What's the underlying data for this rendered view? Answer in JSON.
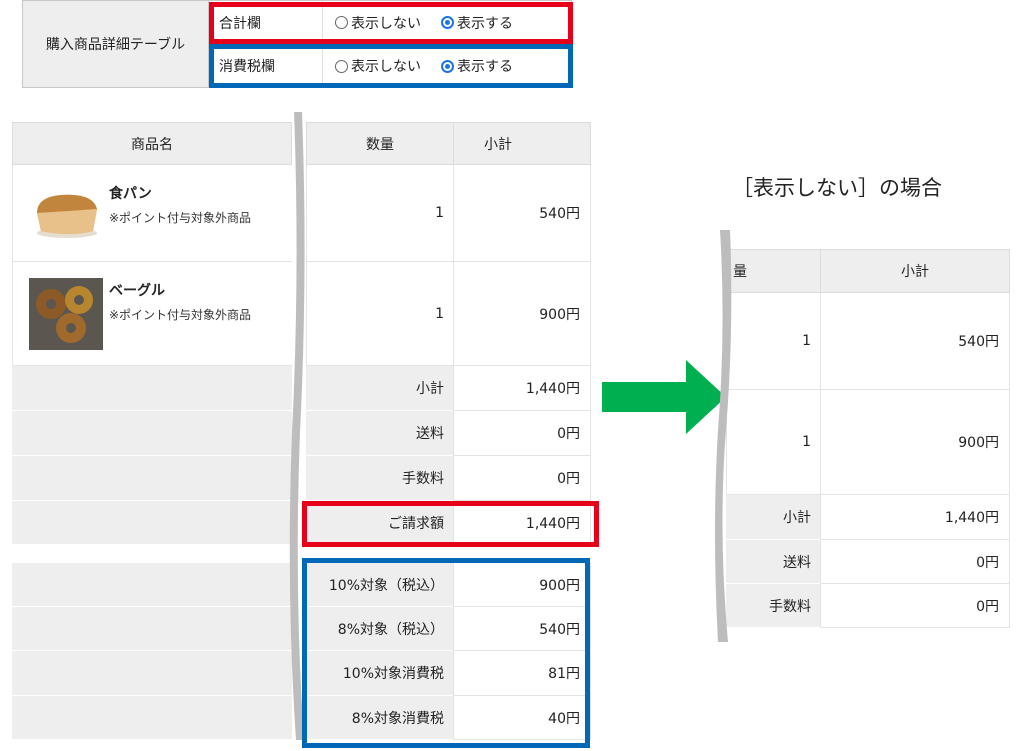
{
  "settings": {
    "title": "購入商品詳細テーブル",
    "rows": [
      {
        "label": "合計欄",
        "options": [
          "表示しない",
          "表示する"
        ],
        "selected": "表示する"
      },
      {
        "label": "消費税欄",
        "options": [
          "表示しない",
          "表示する"
        ],
        "selected": "表示する"
      }
    ]
  },
  "order_table": {
    "headers": {
      "product": "商品名",
      "quantity": "数量",
      "subtotal": "小計"
    },
    "items": [
      {
        "name": "食パン",
        "note": "※ポイント付与対象外商品",
        "quantity": "1",
        "price": "540円"
      },
      {
        "name": "ベーグル",
        "note": "※ポイント付与対象外商品",
        "quantity": "1",
        "price": "900円"
      }
    ],
    "summary": [
      {
        "label": "小計",
        "value": "1,440円"
      },
      {
        "label": "送料",
        "value": "0円"
      },
      {
        "label": "手数料",
        "value": "0円"
      },
      {
        "label": "ご請求額",
        "value": "1,440円"
      }
    ],
    "tax": [
      {
        "label": "10%対象（税込）",
        "value": "900円"
      },
      {
        "label": "8%対象（税込）",
        "value": "540円"
      },
      {
        "label": "10%対象消費税",
        "value": "81円"
      },
      {
        "label": "8%対象消費税",
        "value": "40円"
      }
    ]
  },
  "caption": "［表示しない］の場合",
  "preview_table": {
    "headers": {
      "quantity_cut": "量",
      "subtotal": "小計"
    },
    "rows": [
      {
        "quantity": "1",
        "price": "540円"
      },
      {
        "quantity": "1",
        "price": "900円"
      }
    ],
    "summary": [
      {
        "label": "小計",
        "value": "1,440円"
      },
      {
        "label": "送料",
        "value": "0円"
      },
      {
        "label": "手数料",
        "value": "0円"
      }
    ]
  },
  "colors": {
    "highlight_total": "#e6001a",
    "highlight_tax": "#0068b7",
    "arrow": "#00b050",
    "divider": "#bdbdbd"
  }
}
